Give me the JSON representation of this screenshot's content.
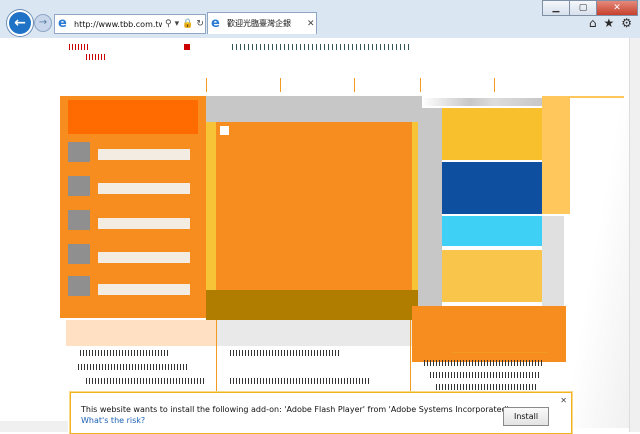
{
  "browser": {
    "url": "http://www.tbb.com.tw/w",
    "tab_title": "歡迎光臨臺灣企銀",
    "win_minimize": "▁",
    "win_maximize": "▢",
    "win_close": "✕",
    "icons": {
      "back": "back-arrow-icon",
      "forward": "forward-arrow-icon",
      "home": "home-icon",
      "favorites": "star-icon",
      "tools": "gear-icon"
    }
  },
  "notification": {
    "message": "This website wants to install the following add-on: 'Adobe Flash Player' from 'Adobe Systems Incorporated'.",
    "link": "What's the risk?",
    "install_label": "Install",
    "close_label": "✕"
  },
  "colors": {
    "orange": "#f78c1f",
    "dark_orange": "#ff6b00",
    "gold": "#f8c02c",
    "navy": "#0e4fa0",
    "cyan": "#3fd0f5",
    "olive": "#b07d00"
  }
}
